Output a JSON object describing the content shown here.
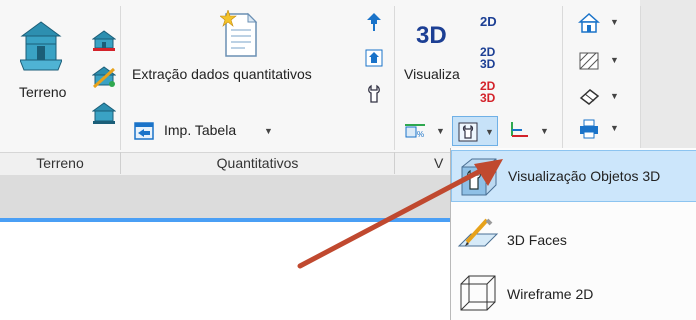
{
  "ribbon": {
    "terreno_group": {
      "button_label": "Terreno",
      "group_label": "Terreno"
    },
    "quantitativos_group": {
      "extract_label": "Extração dados quantitativos",
      "import_label": "Imp. Tabela",
      "group_label": "Quantitativos"
    },
    "visualiza_group": {
      "big_3d_text": "3D",
      "visualiza_label": "Visualiza",
      "badge_2d": "2D",
      "badge_2d3d_a_top": "2D",
      "badge_2d3d_a_bottom": "3D",
      "badge_2d3d_b_top": "2D",
      "badge_2d3d_b_bottom": "3D",
      "group_label_partial": "V"
    }
  },
  "dropdown_menu": {
    "items": [
      {
        "label": "Visualização Objetos 3D",
        "selected": true
      },
      {
        "label": "3D Faces",
        "selected": false
      },
      {
        "label": "Wireframe 2D",
        "selected": false
      }
    ]
  },
  "colors": {
    "arrow": "#c0492f",
    "highlight": "#cce6fb",
    "accent_blue": "#1a73c9",
    "badge_red": "#d3222a",
    "badge_navy": "#1c3f94"
  }
}
